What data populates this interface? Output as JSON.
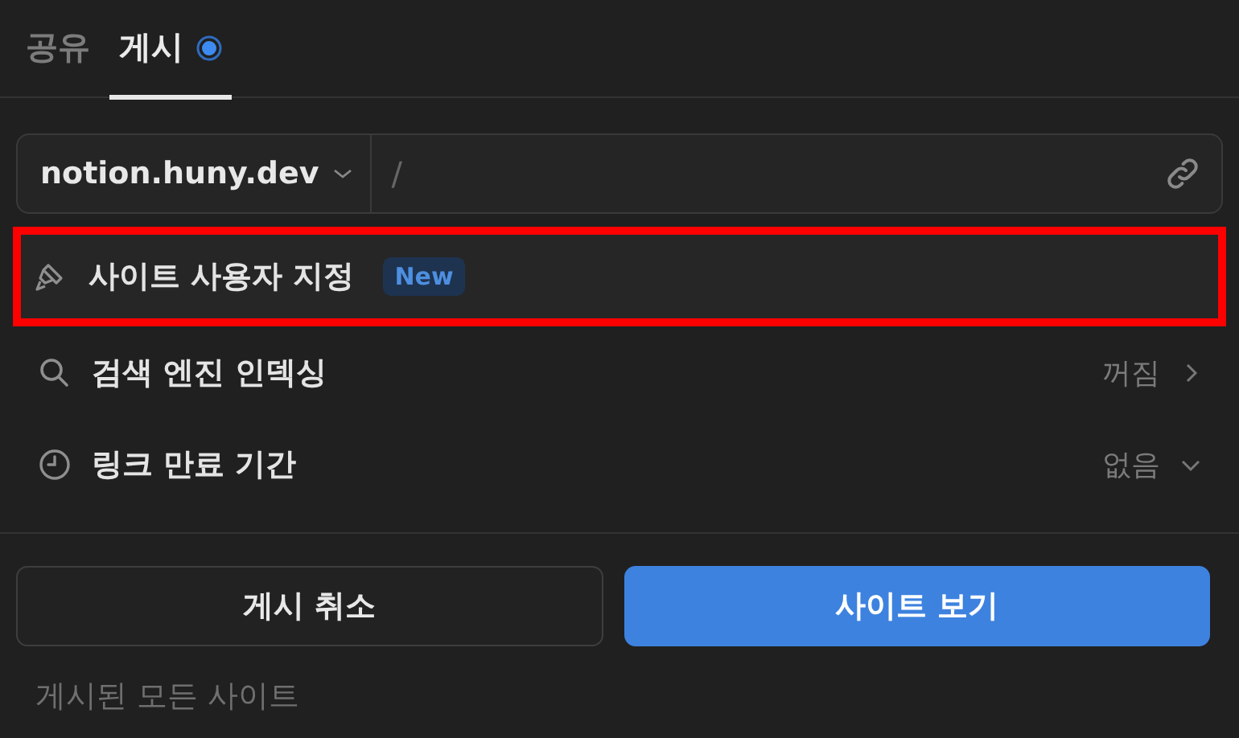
{
  "tabs": [
    {
      "label": "공유",
      "selected": false,
      "dot": false
    },
    {
      "label": "게시",
      "selected": true,
      "dot": true
    }
  ],
  "domain": {
    "value": "notion.huny.dev",
    "path": "/"
  },
  "settings": [
    {
      "kind": "customize",
      "label": "사이트 사용자 지정",
      "badge": "New",
      "highlighted": true
    },
    {
      "kind": "search",
      "label": "검색 엔진 인덱싱",
      "value": "꺼짐",
      "highlighted": false
    },
    {
      "kind": "clock",
      "label": "링크 만료 기간",
      "value": "없음",
      "highlighted": false
    }
  ],
  "buttons": [
    {
      "label": "게시 취소",
      "primary": false
    },
    {
      "label": "사이트 보기",
      "primary": true
    }
  ],
  "footer": "게시된 모든 사이트"
}
